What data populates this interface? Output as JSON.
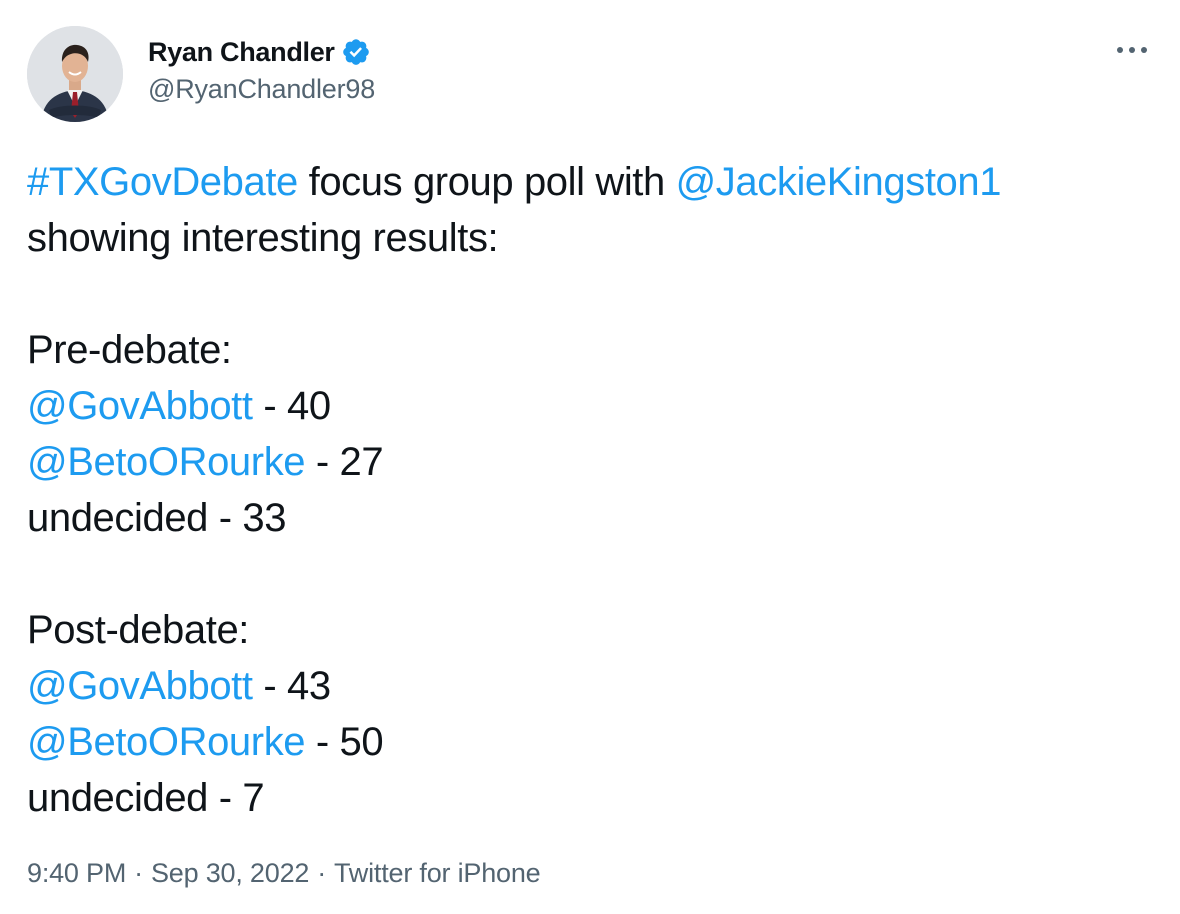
{
  "tweet": {
    "author": {
      "display_name": "Ryan Chandler",
      "handle": "@RyanChandler98",
      "verified": true
    },
    "body": {
      "line1": {
        "hashtag": "#TXGovDebate",
        "text": " focus group poll with ",
        "mention": "@JackieKingston1"
      },
      "line2": "showing interesting results:",
      "pre_debate": {
        "heading": "Pre-debate:",
        "rows": [
          {
            "mention": "@GovAbbott",
            "value": " - 40"
          },
          {
            "mention": "@BetoORourke",
            "value": " - 27"
          }
        ],
        "undecided": "undecided - 33"
      },
      "post_debate": {
        "heading": "Post-debate:",
        "rows": [
          {
            "mention": "@GovAbbott",
            "value": " - 43"
          },
          {
            "mention": "@BetoORourke",
            "value": " - 50"
          }
        ],
        "undecided": "undecided - 7"
      }
    },
    "meta": {
      "time": "9:40 PM",
      "separator": "·",
      "date": "Sep 30, 2022",
      "source": "Twitter for iPhone"
    }
  },
  "colors": {
    "link": "#1d9bf0",
    "text": "#0f1419",
    "secondary": "#536471",
    "verified_badge": "#1d9bf0"
  },
  "icons": [
    "avatar-photo",
    "verified-badge-icon",
    "more-options-icon"
  ]
}
